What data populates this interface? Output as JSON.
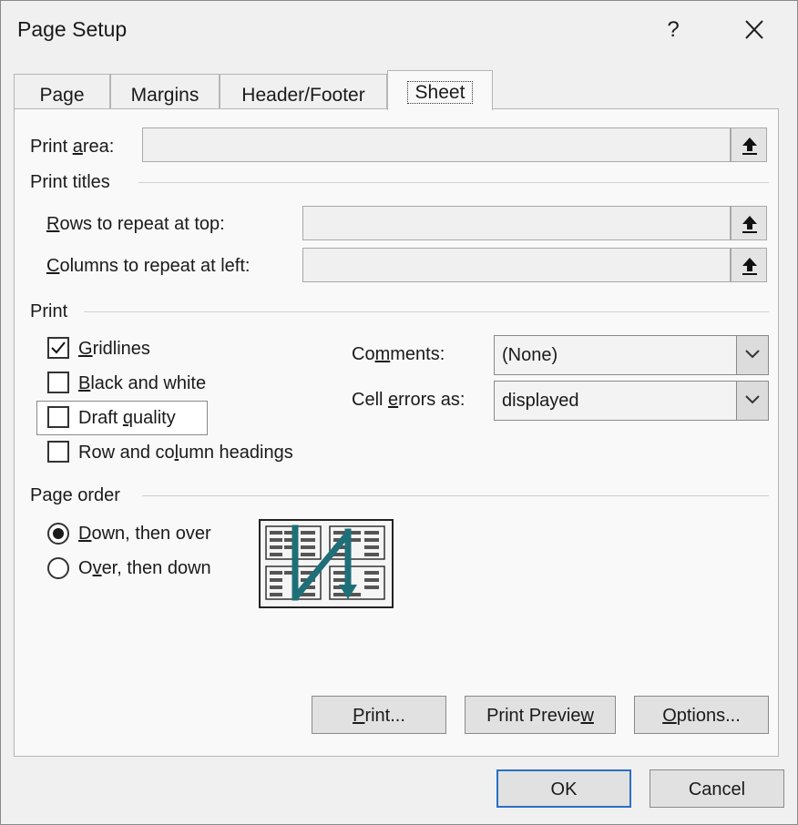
{
  "dialog": {
    "title": "Page Setup",
    "help_label": "?",
    "close_icon": "close-icon"
  },
  "tabs": [
    {
      "label": "Page",
      "active": false
    },
    {
      "label": "Margins",
      "active": false
    },
    {
      "label": "Header/Footer",
      "active": false
    },
    {
      "label": "Sheet",
      "active": true
    }
  ],
  "sheet": {
    "print_area": {
      "label_pre": "Print ",
      "label_u": "a",
      "label_post": "rea:",
      "value": ""
    },
    "print_titles": {
      "heading": "Print titles",
      "rows": {
        "label_u": "R",
        "label_post": "ows to repeat at top:",
        "value": ""
      },
      "columns": {
        "label_u": "C",
        "label_post": "olumns to repeat at left:",
        "value": ""
      }
    },
    "print": {
      "heading": "Print",
      "gridlines": {
        "label_u": "G",
        "label_post": "ridlines",
        "checked": true
      },
      "black_white": {
        "label_u": "B",
        "label_post": "lack and white",
        "checked": false
      },
      "draft_quality": {
        "label_pre": "Draft ",
        "label_u": "q",
        "label_post": "uality",
        "checked": false
      },
      "row_col_headings": {
        "label_pre": "Row and co",
        "label_u": "l",
        "label_post": "umn headings",
        "checked": false
      },
      "comments": {
        "label_pre": "Co",
        "label_u": "m",
        "label_post": "ments:",
        "value": "(None)"
      },
      "cell_errors": {
        "label_pre": "Cell ",
        "label_u": "e",
        "label_post": "rrors as:",
        "value": "displayed"
      }
    },
    "page_order": {
      "heading": "Page order",
      "down_then_over": {
        "label_u": "D",
        "label_post": "own, then over",
        "selected": true
      },
      "over_then_down": {
        "label_pre": "O",
        "label_u": "v",
        "label_post": "er, then down",
        "selected": false
      }
    }
  },
  "buttons": {
    "print": {
      "label_u": "P",
      "label_post": "rint..."
    },
    "print_preview": {
      "label_pre": "Print Previe",
      "label_u": "w",
      "label_post": ""
    },
    "options": {
      "label_u": "O",
      "label_post": "ptions..."
    },
    "ok": "OK",
    "cancel": "Cancel"
  },
  "colors": {
    "accent": "#2a6fc4",
    "page_order_arrow": "#1f6f78"
  }
}
